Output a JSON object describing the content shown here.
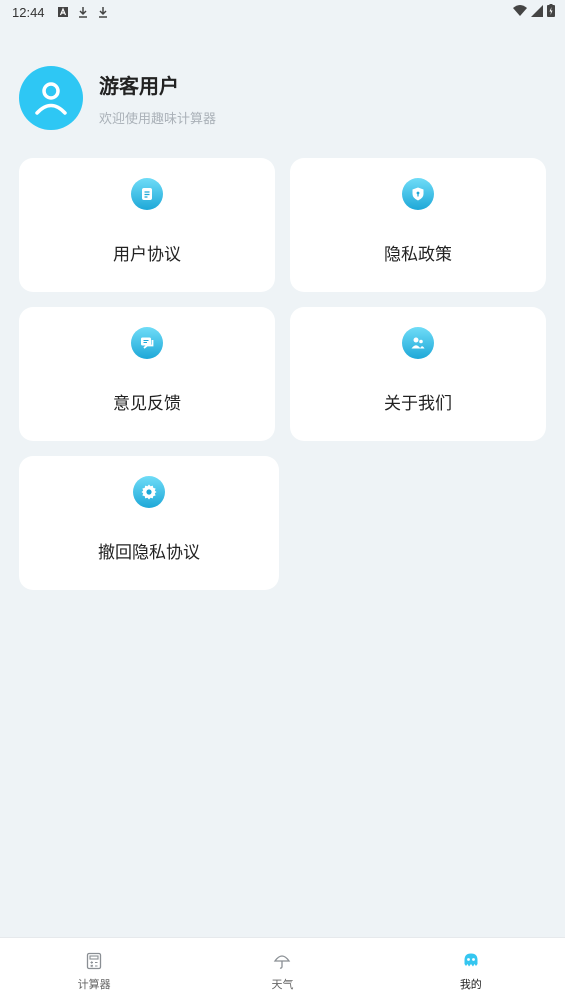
{
  "status_bar": {
    "time": "12:44"
  },
  "profile": {
    "name": "游客用户",
    "subtitle": "欢迎使用趣味计算器"
  },
  "menu": [
    {
      "label": "用户协议",
      "icon": "document-icon"
    },
    {
      "label": "隐私政策",
      "icon": "shield-icon"
    },
    {
      "label": "意见反馈",
      "icon": "chat-icon"
    },
    {
      "label": "关于我们",
      "icon": "people-icon"
    },
    {
      "label": "撤回隐私协议",
      "icon": "gear-icon"
    }
  ],
  "tabs": [
    {
      "label": "计算器",
      "icon": "calculator-icon",
      "active": false
    },
    {
      "label": "天气",
      "icon": "umbrella-icon",
      "active": false
    },
    {
      "label": "我的",
      "icon": "octopus-icon",
      "active": true
    }
  ],
  "colors": {
    "accent": "#2ec7f4",
    "background": "#eef3f6",
    "active_tab": "#35c6f0"
  }
}
